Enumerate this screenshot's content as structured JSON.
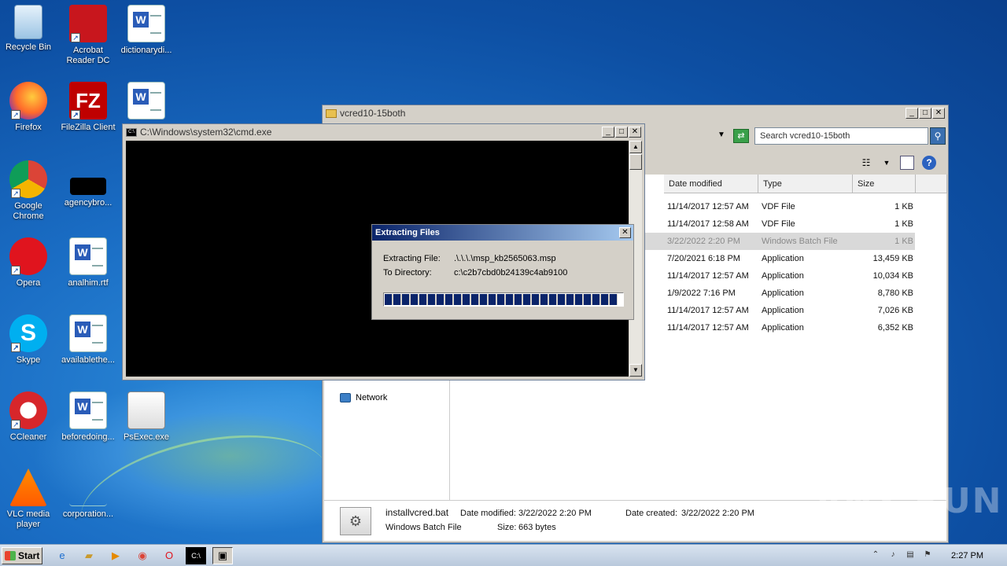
{
  "desktop": {
    "icons": [
      {
        "label": "Recycle Bin"
      },
      {
        "label": "Acrobat Reader DC"
      },
      {
        "label": "dictionarydi..."
      },
      {
        "label": "Firefox"
      },
      {
        "label": "FileZilla Client"
      },
      {
        "label": "Google Chrome"
      },
      {
        "label": "agencybro..."
      },
      {
        "label": "Opera"
      },
      {
        "label": "analhim.rtf"
      },
      {
        "label": "Skype"
      },
      {
        "label": "availablethe..."
      },
      {
        "label": "CCleaner"
      },
      {
        "label": "beforedoing..."
      },
      {
        "label": "PsExec.exe"
      },
      {
        "label": "VLC media player"
      },
      {
        "label": "corporation..."
      }
    ]
  },
  "explorer": {
    "title": "vcred10-15both",
    "search_placeholder": "Search vcred10-15both",
    "columns": {
      "date": "Date modified",
      "type": "Type",
      "size": "Size"
    },
    "rows": [
      {
        "date": "11/14/2017 12:57 AM",
        "type": "VDF File",
        "size": "1 KB"
      },
      {
        "date": "11/14/2017 12:58 AM",
        "type": "VDF File",
        "size": "1 KB"
      },
      {
        "date": "3/22/2022 2:20 PM",
        "type": "Windows Batch File",
        "size": "1 KB"
      },
      {
        "date": "7/20/2021 6:18 PM",
        "type": "Application",
        "size": "13,459 KB"
      },
      {
        "date": "11/14/2017 12:57 AM",
        "type": "Application",
        "size": "10,034 KB"
      },
      {
        "date": "1/9/2022 7:16 PM",
        "type": "Application",
        "size": "8,780 KB"
      },
      {
        "date": "11/14/2017 12:57 AM",
        "type": "Application",
        "size": "7,026 KB"
      },
      {
        "date": "11/14/2017 12:57 AM",
        "type": "Application",
        "size": "6,352 KB"
      }
    ],
    "nav_network": "Network",
    "details": {
      "filename": "installvcred.bat",
      "filetype": "Windows Batch File",
      "date_modified_label": "Date modified:",
      "date_modified": "3/22/2022 2:20 PM",
      "size_label": "Size:",
      "size": "663 bytes",
      "date_created_label": "Date created:",
      "date_created": "3/22/2022 2:20 PM"
    }
  },
  "cmd": {
    "title": "C:\\Windows\\system32\\cmd.exe"
  },
  "extract": {
    "title": "Extracting Files",
    "file_label": "Extracting File:",
    "file_value": ".\\.\\.\\.\\msp_kb2565063.msp",
    "dir_label": "To Directory:",
    "dir_value": "c:\\c2b7cbd0b24139c4ab9100",
    "progress": 0.98
  },
  "taskbar": {
    "start_label": "Start",
    "clock": "2:27 PM"
  },
  "watermark": "ANY RUN"
}
